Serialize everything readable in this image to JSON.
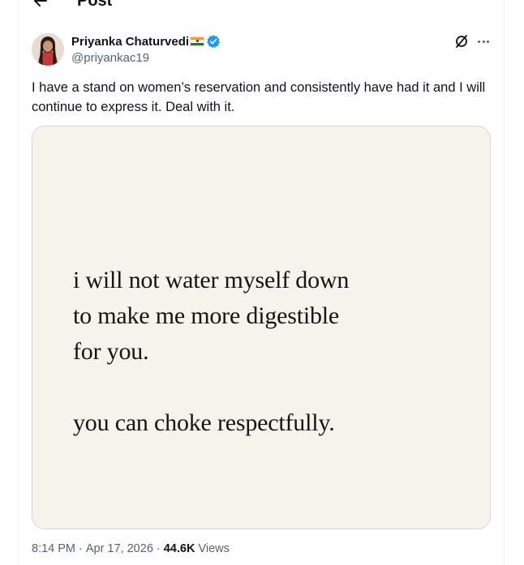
{
  "header": {
    "title": "Post",
    "back_icon": "arrow-left-icon"
  },
  "author": {
    "display_name": "Priyanka Chaturvedi",
    "handle": "@priyankac19",
    "flag_icon": "india-flag-icon",
    "verified_icon": "verified-badge-icon",
    "verified_color": "#1d9bf0"
  },
  "actions": {
    "grok_icon": "grok-icon",
    "more_icon": "more-options-icon"
  },
  "tweet": {
    "text": "I have a stand on women’s reservation and consistently have had it and I will continue to express it. Deal with it."
  },
  "media": {
    "background": "#f6f3ec",
    "lines": [
      "i will not water myself down",
      "to make me more digestible",
      "for you."
    ],
    "closing_line": "you can choke respectfully."
  },
  "meta": {
    "time": "8:14 PM",
    "date": "Apr 17, 2026",
    "separator": "·",
    "views_count": "44.6K",
    "views_label": "Views"
  }
}
